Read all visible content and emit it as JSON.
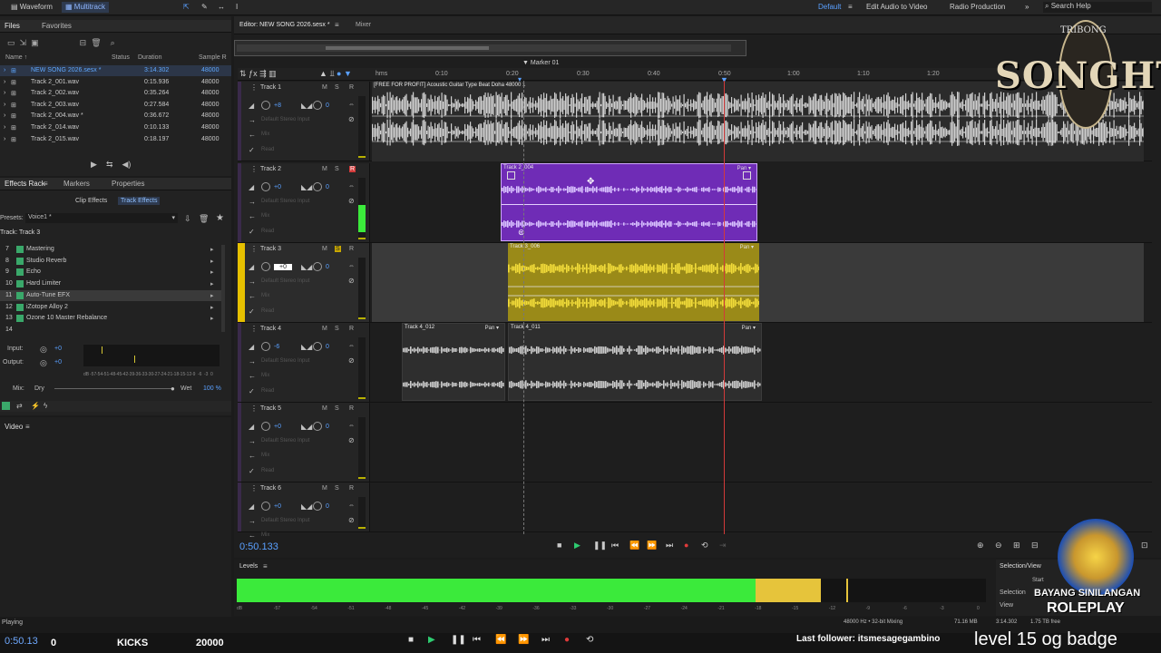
{
  "topbar": {
    "waveform_tab": "Waveform",
    "multitrack_tab": "Multitrack",
    "workspace": "Default",
    "edit_audio_to_video": "Edit Audio to Video",
    "radio_production": "Radio Production",
    "search_placeholder": "Search Help"
  },
  "files_panel": {
    "tabs": [
      "Files",
      "Favorites"
    ],
    "columns": [
      "Name ↑",
      "Status",
      "Duration",
      "Sample R"
    ],
    "rows": [
      {
        "name": "NEW SONG 2026.sesx *",
        "duration": "3:14.302",
        "rate": "48000",
        "selected": true
      },
      {
        "name": "Track 2_001.wav",
        "duration": "0:15.936",
        "rate": "48000"
      },
      {
        "name": "Track 2_002.wav",
        "duration": "0:35.264",
        "rate": "48000"
      },
      {
        "name": "Track 2_003.wav",
        "duration": "0:27.584",
        "rate": "48000"
      },
      {
        "name": "Track 2_004.wav *",
        "duration": "0:36.672",
        "rate": "48000"
      },
      {
        "name": "Track 2_014.wav",
        "duration": "0:10.133",
        "rate": "48000"
      },
      {
        "name": "Track 2_015.wav",
        "duration": "0:18.197",
        "rate": "48000"
      }
    ]
  },
  "effects_panel": {
    "tabs": [
      "Effects Rack",
      "Markers",
      "Properties"
    ],
    "subtabs": [
      "Clip Effects",
      "Track Effects"
    ],
    "presets_label": "Presets:",
    "preset_value": "Voice1 *",
    "track_label": "Track: Track 3",
    "items": [
      {
        "num": "7",
        "name": "Mastering"
      },
      {
        "num": "8",
        "name": "Studio Reverb"
      },
      {
        "num": "9",
        "name": "Echo"
      },
      {
        "num": "10",
        "name": "Hard Limiter"
      },
      {
        "num": "11",
        "name": "Auto-Tune EFX",
        "selected": true
      },
      {
        "num": "12",
        "name": "iZotope Alloy 2"
      },
      {
        "num": "13",
        "name": "Ozone 10 Master Rebalance"
      },
      {
        "num": "14",
        "name": ""
      }
    ],
    "input_label": "Input:",
    "input_value": "+0",
    "output_label": "Output:",
    "output_value": "+0",
    "mix_label": "Mix:",
    "dry_label": "Dry",
    "wet_label": "Wet",
    "wet_value": "100 %",
    "meter_ticks": [
      "dB",
      "-57",
      "-54",
      "-51",
      "-48",
      "-45",
      "-42",
      "-39",
      "-36",
      "-33",
      "-30",
      "-27",
      "-24",
      "-21",
      "-18",
      "-15",
      "-12",
      "-9",
      "-6",
      "-3",
      "0"
    ]
  },
  "video_panel": {
    "title": "Video"
  },
  "editor": {
    "tab_title": "Editor: NEW SONG 2026.sesx *",
    "mixer_tab": "Mixer",
    "marker": "Marker 01",
    "ruler": [
      "hms",
      "0:10",
      "0:20",
      "0:30",
      "0:40",
      "0:50",
      "1:00",
      "1:10",
      "1:20"
    ],
    "tracks": [
      {
        "name": "Track 1",
        "vol": "+8",
        "pan": "0",
        "input": "Default Stereo Input",
        "output": "Mix",
        "read": "Read"
      },
      {
        "name": "Track 2",
        "vol": "+0",
        "pan": "0",
        "input": "Default Stereo Input",
        "output": "Mix",
        "read": "Read"
      },
      {
        "name": "Track 3",
        "vol": "+0",
        "pan": "0",
        "input": "Default Stereo Input",
        "output": "Mix",
        "read": "Read"
      },
      {
        "name": "Track 4",
        "vol": "-6",
        "pan": "0",
        "input": "Default Stereo Input",
        "output": "Mix",
        "read": "Read"
      },
      {
        "name": "Track 5",
        "vol": "+0",
        "pan": "0",
        "input": "Default Stereo Input",
        "output": "Mix",
        "read": "Read"
      },
      {
        "name": "Track 6",
        "vol": "+0",
        "pan": "0",
        "input": "Default Stereo Input",
        "output": "Mix",
        "read": "Read"
      }
    ],
    "clips": {
      "t1": "[FREE FOR PROFIT] Acoustic Guitar Type Beat Doha 48000 1",
      "t2": "Track 2_004",
      "t3": "Track 3_006",
      "t4a": "Track 4_012",
      "t4b": "Track 4_011",
      "pan": "Pan"
    },
    "time": "0:50.133"
  },
  "levels": {
    "title": "Levels",
    "ticks": [
      "dB",
      "-57",
      "-54",
      "-51",
      "-48",
      "-45",
      "-42",
      "-39",
      "-36",
      "-33",
      "-30",
      "-27",
      "-24",
      "-21",
      "-18",
      "-15",
      "-12",
      "-9",
      "-6",
      "-3",
      "0"
    ]
  },
  "selview": {
    "title": "Selection/View",
    "start": "Start",
    "selection": "Selection",
    "view": "View"
  },
  "status": {
    "state": "Playing",
    "format": "48000 Hz • 32-bit Mixing",
    "memory": "71.16 MB",
    "duration": "3:14.302",
    "free": "1.75 TB free"
  },
  "overlay": {
    "logo_top": "TRIBONG",
    "logo_main": "SONGHT",
    "time": "0:50.13",
    "counter1": "0",
    "kicks": "KICKS",
    "kicks_value": "20000",
    "follower": "Last follower: itsmesagegambino",
    "badge": "level 15 og badge",
    "brand1": "BAYANG SINILANGAN",
    "brand2": "ROLEPLAY"
  }
}
